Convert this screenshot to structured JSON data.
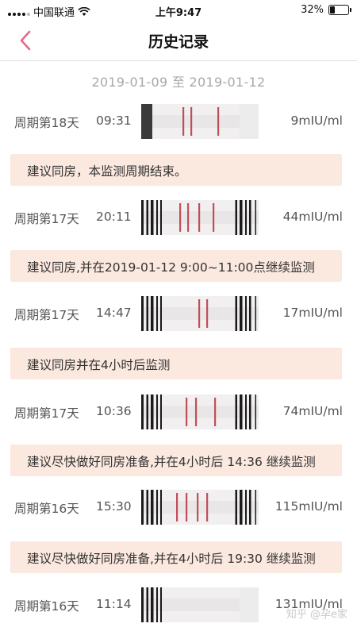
{
  "status_bar": {
    "carrier": "中国联通",
    "time": "上午9:47",
    "battery": "32%",
    "battery_level": 0.32,
    "icons": [
      "signal-icon",
      "wifi-icon",
      "battery-icon"
    ]
  },
  "nav": {
    "title": "历史记录",
    "back_icon": "chevron-left-icon"
  },
  "date_range": "2019-01-09 至 2019-01-12",
  "records": [
    {
      "cycle_day": "周期第18天",
      "time": "09:31",
      "value": "9mIU/ml"
    },
    {
      "cycle_day": "周期第17天",
      "time": "20:11",
      "value": "44mIU/ml"
    },
    {
      "cycle_day": "周期第17天",
      "time": "14:47",
      "value": "17mIU/ml"
    },
    {
      "cycle_day": "周期第17天",
      "time": "10:36",
      "value": "74mIU/ml"
    },
    {
      "cycle_day": "周期第16天",
      "time": "15:30",
      "value": "115mIU/ml"
    },
    {
      "cycle_day": "周期第16天",
      "time": "11:14",
      "value": "131mIU/ml"
    }
  ],
  "advice": [
    "建议同房，本监测周期结束。",
    "建议同房,并在2019-01-12 9:00~11:00点继续监测",
    "建议同房并在4小时后监测",
    "建议尽快做好同房准备,并在4小时后 14:36 继续监测",
    "建议尽快做好同房准备,并在4小时后 19:30 继续监测"
  ],
  "watermark": "知乎 @孕e家",
  "colors": {
    "accent": "#e36a8a",
    "advice_bg": "#fbe8df",
    "line": "#b8323f"
  }
}
